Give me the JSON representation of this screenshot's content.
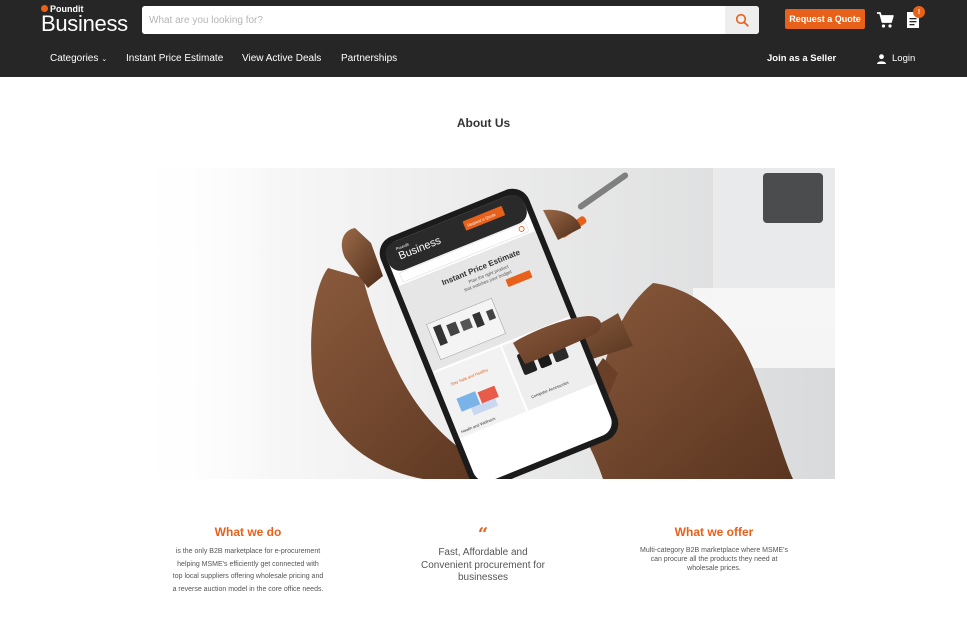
{
  "header": {
    "logo_top": "Poundit",
    "logo_main": "Business",
    "search_placeholder": "What are you looking for?",
    "quote_button": "Request a Quote",
    "notification_count": "!"
  },
  "nav": {
    "categories": "Categories",
    "instant_price_estimate": "Instant Price Estimate",
    "view_active_deals": "View Active Deals",
    "partnerships": "Partnerships",
    "join_seller": "Join as a Seller",
    "login": "Login"
  },
  "page": {
    "title": "About Us"
  },
  "hero": {
    "phone_logo": "Business",
    "phone_logo_top": "Poundit",
    "phone_quote": "Request a Quote",
    "phone_banner_title": "Instant Price Estimate",
    "phone_banner_sub1": "Plan the right product",
    "phone_banner_sub2": "that matches your budget",
    "phone_tile1": "Stay Safe and Healthy",
    "phone_tile1_label": "Health and Wellness",
    "phone_tile2_label": "Computer Accessories"
  },
  "sections": {
    "what_we_do_title": "What we do",
    "what_we_do_text": [
      "is the only B2B marketplace for e-procurement",
      "helping MSME's efficiently get connected with",
      "top local suppliers offering wholesale pricing and",
      "a reverse auction model in the core office needs."
    ],
    "quote_mark": "“",
    "tagline": [
      "Fast, Affordable and",
      "Convenient procurement for",
      "businesses"
    ],
    "what_we_offer_title": "What we offer",
    "what_we_offer_text": [
      "Multi-category B2B marketplace where MSME's",
      "can procure all the products they need at",
      "wholesale prices."
    ]
  },
  "colors": {
    "accent": "#e8611a",
    "header_bg": "#262626"
  }
}
